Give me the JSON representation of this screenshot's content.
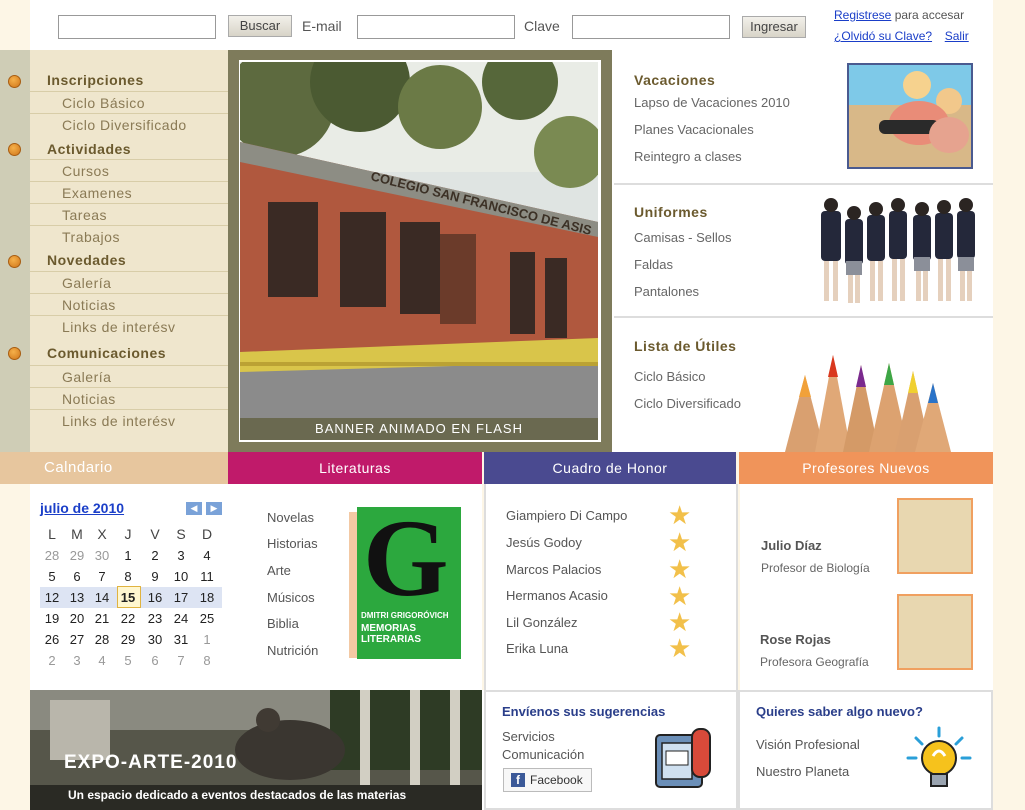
{
  "top": {
    "search_button": "Buscar",
    "email_label": "E-mail",
    "password_label": "Clave",
    "login_button": "Ingresar",
    "register_link": "Registrese",
    "register_text": "para accesar",
    "forgot_link": "¿Olvidó su Clave?",
    "logout_link": "Salir"
  },
  "sidebar": {
    "sections": [
      {
        "title": "Inscripciones",
        "items": [
          "Ciclo Básico",
          "Ciclo Diversificado"
        ]
      },
      {
        "title": "Actividades",
        "items": [
          "Cursos",
          "Examenes",
          "Tareas",
          "Trabajos"
        ]
      },
      {
        "title": "Novedades",
        "items": [
          "Galería",
          "Noticias",
          "Links de interésv"
        ]
      },
      {
        "title": "Comunicaciones",
        "items": [
          "Galería",
          "Noticias",
          "Links de interésv"
        ]
      }
    ]
  },
  "banner": {
    "caption": "BANNER ANIMADO EN FLASH",
    "sign_text": "COLEGIO SAN FRANCISCO DE ASIS"
  },
  "right": {
    "vacaciones": {
      "title": "Vacaciones",
      "items": [
        "Lapso de Vacaciones 2010",
        "Planes Vacacionales",
        "Reintegro a clases"
      ]
    },
    "uniformes": {
      "title": "Uniformes",
      "items": [
        "Camisas - Sellos",
        "Faldas",
        "Pantalones"
      ]
    },
    "utiles": {
      "title": "Lista de Útiles",
      "items": [
        "Ciclo Básico",
        "Ciclo Diversificado"
      ]
    }
  },
  "headers": {
    "calendario": "Calndario",
    "literaturas": "Literaturas",
    "cuadro": "Cuadro de Honor",
    "profesores": "Profesores Nuevos"
  },
  "calendar": {
    "month": "julio de 2010",
    "weekdays": [
      "L",
      "M",
      "X",
      "J",
      "V",
      "S",
      "D"
    ],
    "weeks": [
      [
        "28",
        "29",
        "30",
        "1",
        "2",
        "3",
        "4"
      ],
      [
        "5",
        "6",
        "7",
        "8",
        "9",
        "10",
        "11"
      ],
      [
        "12",
        "13",
        "14",
        "15",
        "16",
        "17",
        "18"
      ],
      [
        "19",
        "20",
        "21",
        "22",
        "23",
        "24",
        "25"
      ],
      [
        "26",
        "27",
        "28",
        "29",
        "30",
        "31",
        "1"
      ],
      [
        "2",
        "3",
        "4",
        "5",
        "6",
        "7",
        "8"
      ]
    ],
    "today": "15"
  },
  "literaturas": {
    "items": [
      "Novelas",
      "Historias",
      "Arte",
      "Músicos",
      "Biblia",
      "Nutrición"
    ],
    "book_letter": "G",
    "book_author": "DMITRI GRIGORÓVICH",
    "book_title": "MEMORIAS LITERARIAS"
  },
  "honor": {
    "names": [
      "Giampiero Di Campo",
      "Jesús Godoy",
      "Marcos Palacios",
      "Hermanos Acasio",
      "Lil González",
      "Erika Luna"
    ]
  },
  "profesores": [
    {
      "name": "Julio Díaz",
      "role": "Profesor de Biología"
    },
    {
      "name": "Rose Rojas",
      "role": "Profesora Geografía"
    }
  ],
  "expo": {
    "title": "EXPO-ARTE-2010",
    "subtitle": "Un espacio dedicado a eventos destacados de las materias"
  },
  "sugerencias": {
    "title": "Envíenos sus sugerencias",
    "items": [
      "Servicios",
      "Comunicación"
    ],
    "facebook": "Facebook"
  },
  "nuevo": {
    "title": "Quieres saber algo nuevo?",
    "items": [
      "Visión Profesional",
      "Nuestro Planeta"
    ]
  },
  "colors": {
    "literaturas": "#c01a6a",
    "cuadro": "#4a4a90",
    "profesores": "#f0945a",
    "calendario": "#d9b489"
  }
}
